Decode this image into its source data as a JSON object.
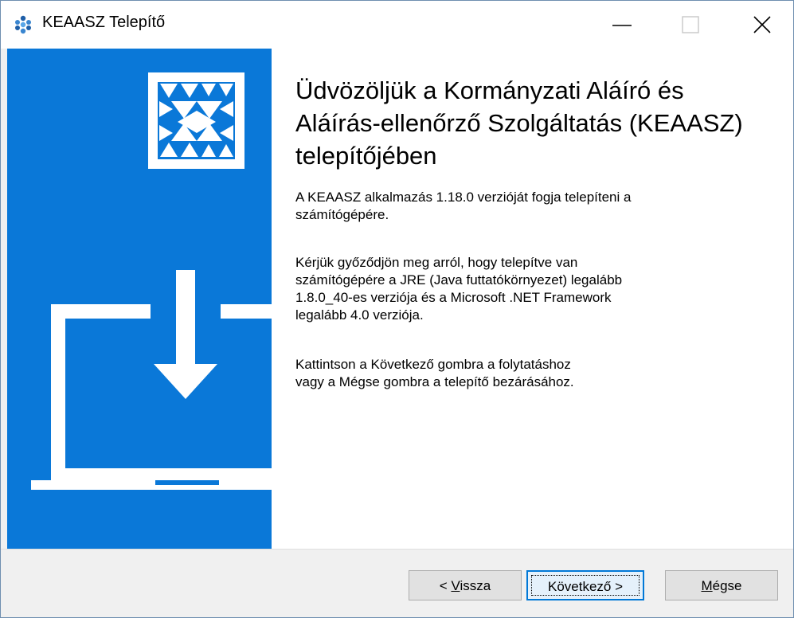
{
  "window": {
    "title": "KEAASZ Telepítő"
  },
  "main": {
    "heading": "Üdvözöljük a Kormányzati Aláíró és Aláírás-ellenőrző Szolgáltatás (KEAASZ) telepítőjében",
    "paragraph1": "A KEAASZ alkalmazás 1.18.0 verzióját fogja telepíteni a\nszámítógépére.",
    "paragraph2": "Kérjük győződjön meg arról, hogy telepítve van\nszámítógépére a JRE (Java futtatókörnyezet) legalább\n1.8.0_40-es verziója és a Microsoft .NET Framework\nlegalább 4.0 verziója.",
    "paragraph3": "Kattintson a Következő gombra a folytatáshoz\nvagy a Mégse gombra a telepítő bezárásához."
  },
  "buttons": {
    "back_prefix": "< ",
    "back_mnemonic": "V",
    "back_rest": "issza",
    "next_label": "Következő >",
    "cancel_mnemonic": "M",
    "cancel_rest": "égse"
  },
  "colors": {
    "sidebar": "#0a78d8",
    "accent": "#0078d7"
  },
  "icons": {
    "app": "keaasz-logo-icon",
    "minimize": "minimize-icon",
    "maximize": "maximize-icon",
    "close": "close-icon",
    "sidebar_logo": "keaasz-emblem-icon",
    "sidebar_graphic": "download-laptop-icon"
  }
}
